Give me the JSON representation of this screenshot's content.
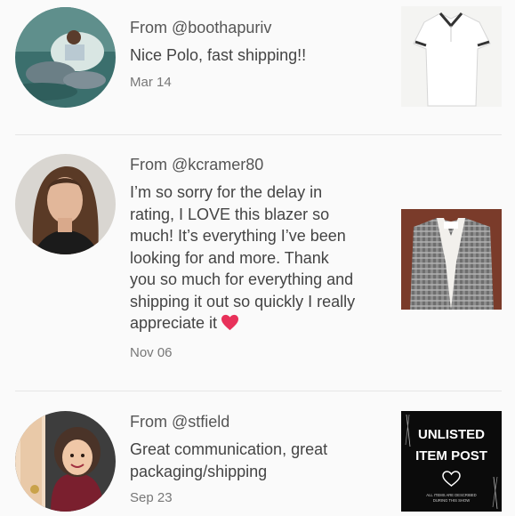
{
  "reviews": [
    {
      "from": "From @boothapuriv",
      "message": "Nice Polo, fast shipping!!",
      "date": "Mar 14",
      "thumb_icon": "white-polo-shirt"
    },
    {
      "from": "From @kcramer80",
      "message_lines": [
        "I’m so sorry for the delay in",
        "rating, I LOVE this blazer so",
        "much! It’s everything I’ve been",
        "looking for and more. Thank",
        "you so much for everything and",
        "shipping it out so quickly I really",
        "appreciate it"
      ],
      "message_emoji": "red-heart",
      "date": "Nov 06",
      "thumb_icon": "plaid-blazer"
    },
    {
      "from": "From @stfield",
      "message_lines": [
        "Great communication, great",
        "packaging/shipping"
      ],
      "date": "Sep 23",
      "thumb": {
        "line1": "UNLISTED",
        "line2": "ITEM POST",
        "fine_print_1": "ALL ITEMS ARE DESCRIBED",
        "fine_print_2": "DURING THIS SHOW"
      }
    }
  ],
  "colors": {
    "background": "#fafafa",
    "divider": "#e6e6e6",
    "heart": "#e8315a"
  }
}
